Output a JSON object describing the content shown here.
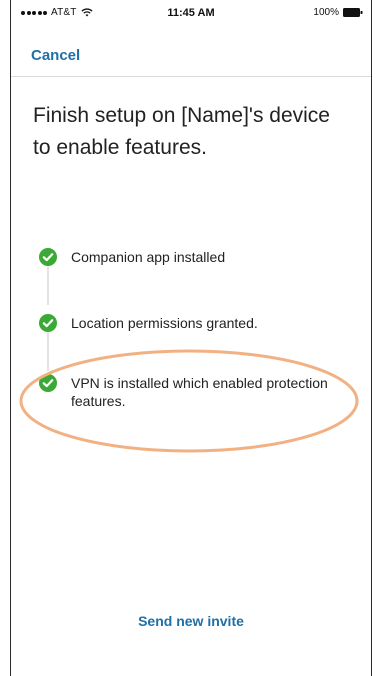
{
  "status_bar": {
    "carrier": "AT&T",
    "time": "11:45 AM",
    "battery": "100%"
  },
  "nav": {
    "cancel_label": "Cancel"
  },
  "main": {
    "title": "Finish setup on [Name]'s device to enable features.",
    "steps": [
      {
        "label": "Companion app installed",
        "status": "complete"
      },
      {
        "label": "Location permissions granted.",
        "status": "complete"
      },
      {
        "label": "VPN is installed which enabled protection features.",
        "status": "complete"
      }
    ],
    "send_invite_label": "Send new invite"
  },
  "colors": {
    "accent": "#1f6fa8",
    "success": "#3aa935",
    "highlight": "#f2b183"
  },
  "icons": {
    "step_status": "check-circle-icon",
    "wifi": "wifi-icon",
    "battery": "battery-icon"
  }
}
